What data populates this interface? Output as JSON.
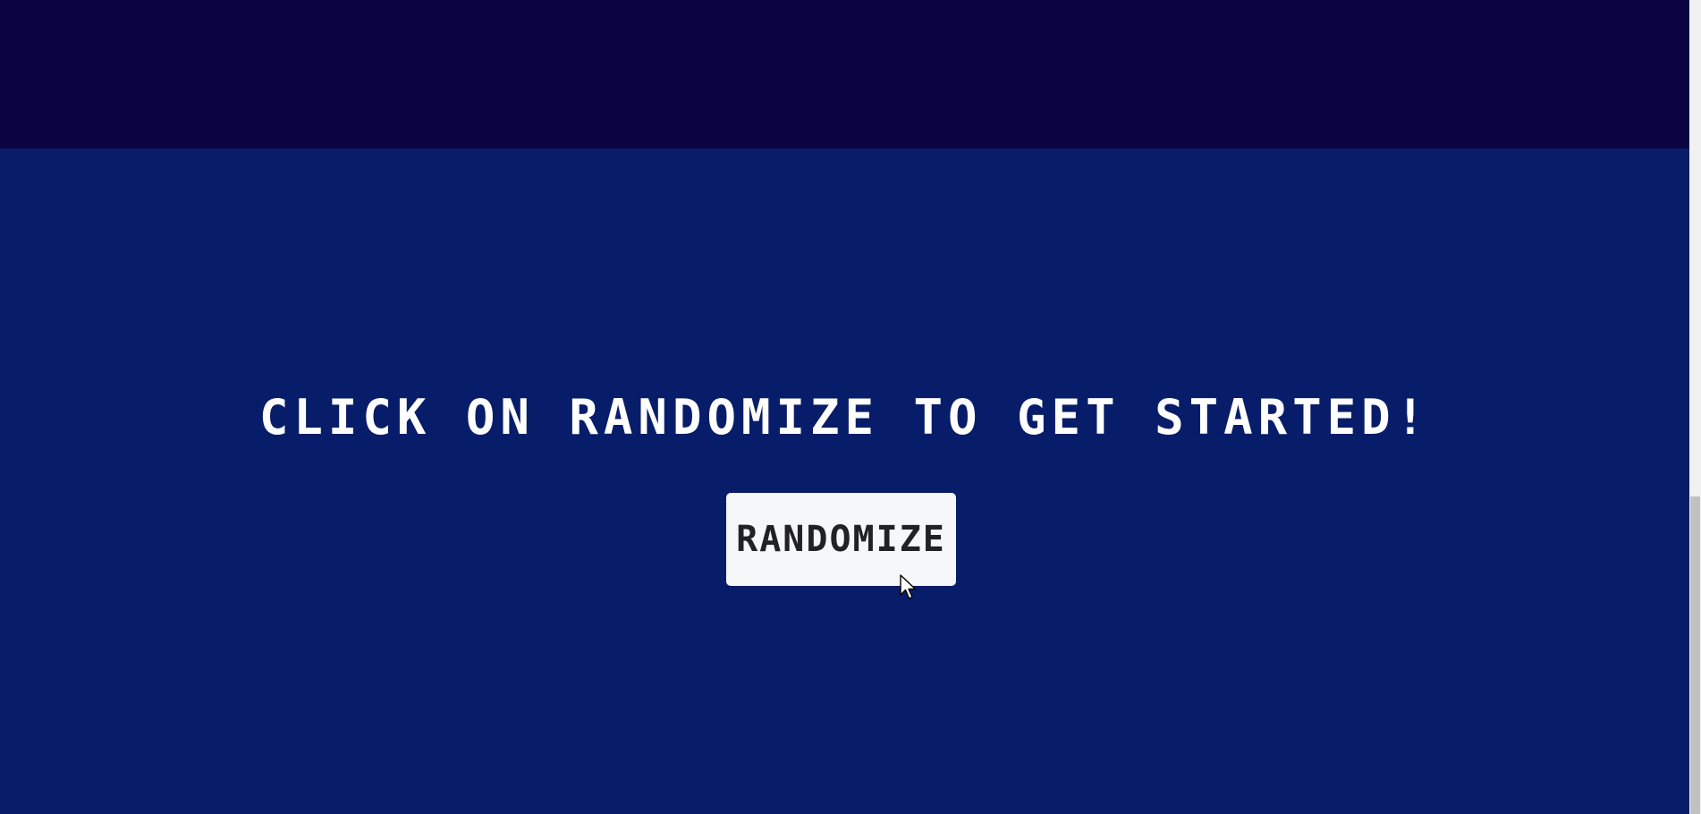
{
  "page": {
    "headline": "CLICK ON RANDOMIZE TO GET STARTED!",
    "button_label": "RANDOMIZE"
  },
  "colors": {
    "top_band": "#0c0442",
    "main_background": "#081d69",
    "headline_text": "#ffffff",
    "button_background": "#f6f7f9",
    "button_text": "#222222"
  },
  "icons": {
    "cursor": "mouse-pointer-icon"
  }
}
